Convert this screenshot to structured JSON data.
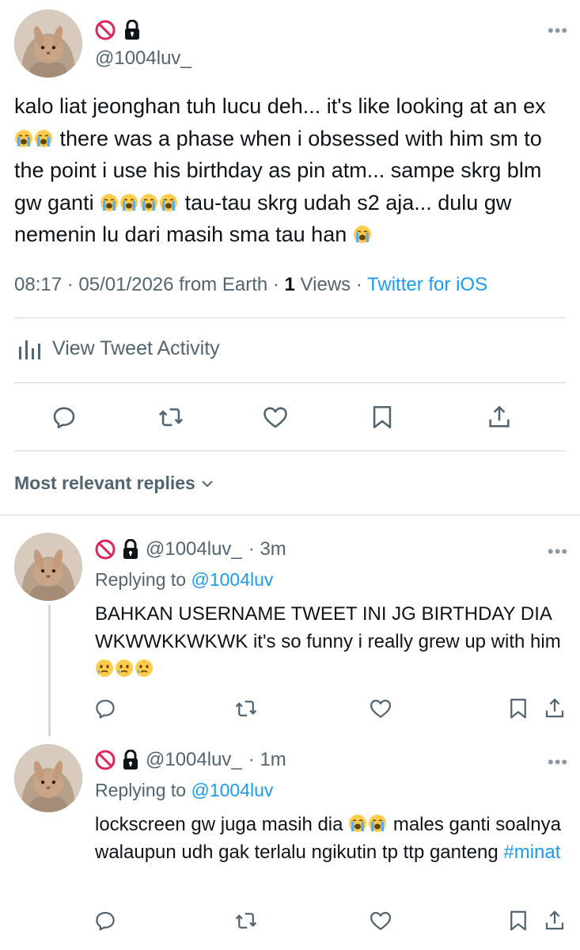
{
  "tweet": {
    "handle": "@1004luv_",
    "more": "•••",
    "text_parts": [
      "kalo liat jeonghan tuh lucu deh... it's like looking at an ex ",
      " there was a phase when i obsessed with him sm to the point i use his birthday as pin atm... sampe skrg blm gw ganti ",
      " tau-tau skrg udah s2 aja... dulu gw nemenin lu dari masih sma tau han "
    ],
    "meta": {
      "time_date": "08:17 · 05/01/2026 from Earth · ",
      "views_count": "1",
      "views_label": " Views · ",
      "client": "Twitter for iOS"
    },
    "activity_label": "View Tweet Activity",
    "icons": {
      "reply": "reply-icon",
      "retweet": "retweet-icon",
      "like": "heart-icon",
      "bookmark": "bookmark-icon",
      "share": "share-icon"
    }
  },
  "replies_header": "Most relevant replies",
  "replies": [
    {
      "handle": "@1004luv_",
      "time": "· 3m",
      "replying_prefix": "Replying to",
      "replying_to": "@1004luv",
      "text_parts": [
        "BAHKAN USERNAME TWEET INI JG BIRTHDAY DIA WKWWKKWKWK it's so funny i really grew up with him "
      ]
    },
    {
      "handle": "@1004luv_",
      "time": "· 1m",
      "replying_prefix": "Replying to",
      "replying_to": "@1004luv",
      "text_parts": [
        "lockscreen gw juga masih dia ",
        " males ganti soalnya walaupun udh gak terlalu ngikutin tp ttp ganteng "
      ],
      "hashtag": "#minat"
    }
  ],
  "colors": {
    "accent": "#1d9bf0",
    "secondary_text": "#536471",
    "divider": "#cfd9de"
  }
}
